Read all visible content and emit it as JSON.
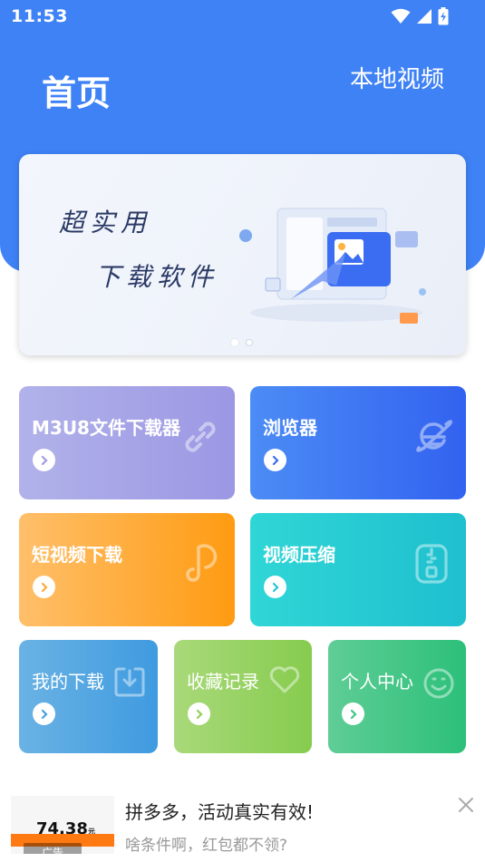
{
  "status_bar": {
    "time": "11:53",
    "icons": [
      "wifi-icon",
      "signal-icon",
      "battery-icon"
    ]
  },
  "header": {
    "title": "首页",
    "local_video": "本地视频"
  },
  "banner": {
    "line1": "超实用",
    "line2": "下载软件",
    "slides": 2,
    "active_slide": 1
  },
  "cards": {
    "m3u8": {
      "label": "M3U8文件下载器",
      "icon": "link-icon"
    },
    "browser": {
      "label": "浏览器",
      "icon": "browser-icon"
    },
    "short_video": {
      "label": "短视频下载",
      "icon": "music-note-icon"
    },
    "compress": {
      "label": "视频压缩",
      "icon": "zip-icon"
    },
    "my_downloads": {
      "label": "我的下载",
      "icon": "download-icon"
    },
    "favorites": {
      "label": "收藏记录",
      "icon": "heart-icon"
    },
    "profile": {
      "label": "个人中心",
      "icon": "smile-icon"
    }
  },
  "ad": {
    "title": "拼多多，活动真实有效!",
    "desc": "啥条件啊，红包都不领?",
    "tag": "广告",
    "price": "74.38",
    "price_unit": "元"
  },
  "colors": {
    "primary": "#3f82f6",
    "orange": "#ff9b12",
    "cyan": "#1fbfcf",
    "green": "#2cc07a"
  }
}
